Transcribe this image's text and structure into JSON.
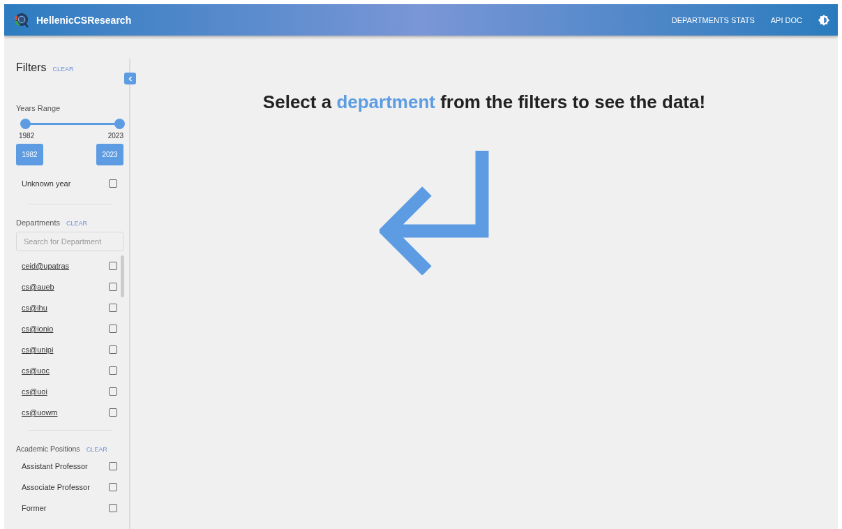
{
  "header": {
    "brand": "HellenicCSResearch",
    "nav": [
      {
        "label": "DEPARTMENTS STATS"
      },
      {
        "label": "API DOC"
      }
    ]
  },
  "filters": {
    "title": "Filters",
    "clear": "CLEAR",
    "years": {
      "label": "Years Range",
      "low": {
        "label": "1982",
        "value": "1982",
        "level": 0
      },
      "high": {
        "label": "2023",
        "value": "2023",
        "level": 1
      },
      "unknown": {
        "label": "Unknown year",
        "checked": false
      }
    },
    "departments": {
      "label": "Departments",
      "clear": "CLEAR",
      "placeholder": "Search for Department",
      "items": [
        {
          "label": "ceid@upatras",
          "checked": false
        },
        {
          "label": "cs@aueb",
          "checked": false
        },
        {
          "label": "cs@ihu",
          "checked": false
        },
        {
          "label": "cs@ionio",
          "checked": false
        },
        {
          "label": "cs@unipi",
          "checked": false
        },
        {
          "label": "cs@uoc",
          "checked": false
        },
        {
          "label": "cs@uoi",
          "checked": false
        },
        {
          "label": "cs@uowm",
          "checked": false
        }
      ]
    },
    "positions": {
      "label": "Academic Positions",
      "clear": "CLEAR",
      "items": [
        {
          "label": "Assistant Professor",
          "checked": false
        },
        {
          "label": "Associate Professor",
          "checked": false
        },
        {
          "label": "Former",
          "checked": false
        }
      ]
    }
  },
  "main": {
    "before": "Select a",
    "highlight": "department",
    "after": "from the filters to see the data!"
  }
}
